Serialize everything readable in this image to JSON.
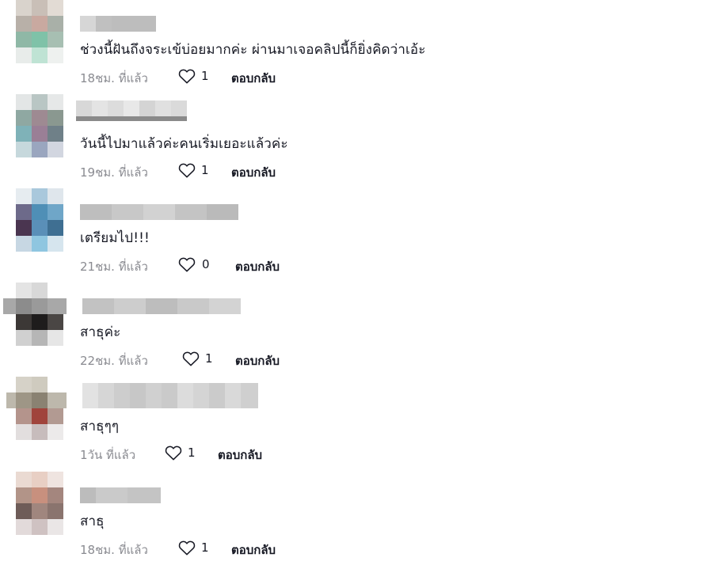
{
  "reply_label": "ตอบกลับ",
  "comments": [
    {
      "text": "ช่วงนี้ฝันถึงจระเข้บ่อยมากค่ะ ผ่านมาเจอคลิปนี้ก็ยิ่งคิดว่าเอ้ะ",
      "time": "18ชม. ที่แล้ว",
      "likes": "1"
    },
    {
      "text": "วันนี้ไปมาแล้วค่ะคนเริ่มเยอะแล้วค่ะ",
      "time": "19ชม. ที่แล้ว",
      "likes": "1"
    },
    {
      "text": "เตรียมไป!!!",
      "time": "21ชม. ที่แล้ว",
      "likes": "0"
    },
    {
      "text": "สาธุค่ะ",
      "time": "22ชม. ที่แล้ว",
      "likes": "1"
    },
    {
      "text": "สาธุๆๆ",
      "time": "1วัน ที่แล้ว",
      "likes": "1"
    },
    {
      "text": "สาธุ",
      "time": "18ชม. ที่แล้ว",
      "likes": "1"
    }
  ],
  "colors": {
    "username_blur": "#c4c4c4",
    "meta_gray": "#8a8b91",
    "heart_stroke": "#161823"
  },
  "icons": {
    "like": "heart-outline-icon"
  }
}
